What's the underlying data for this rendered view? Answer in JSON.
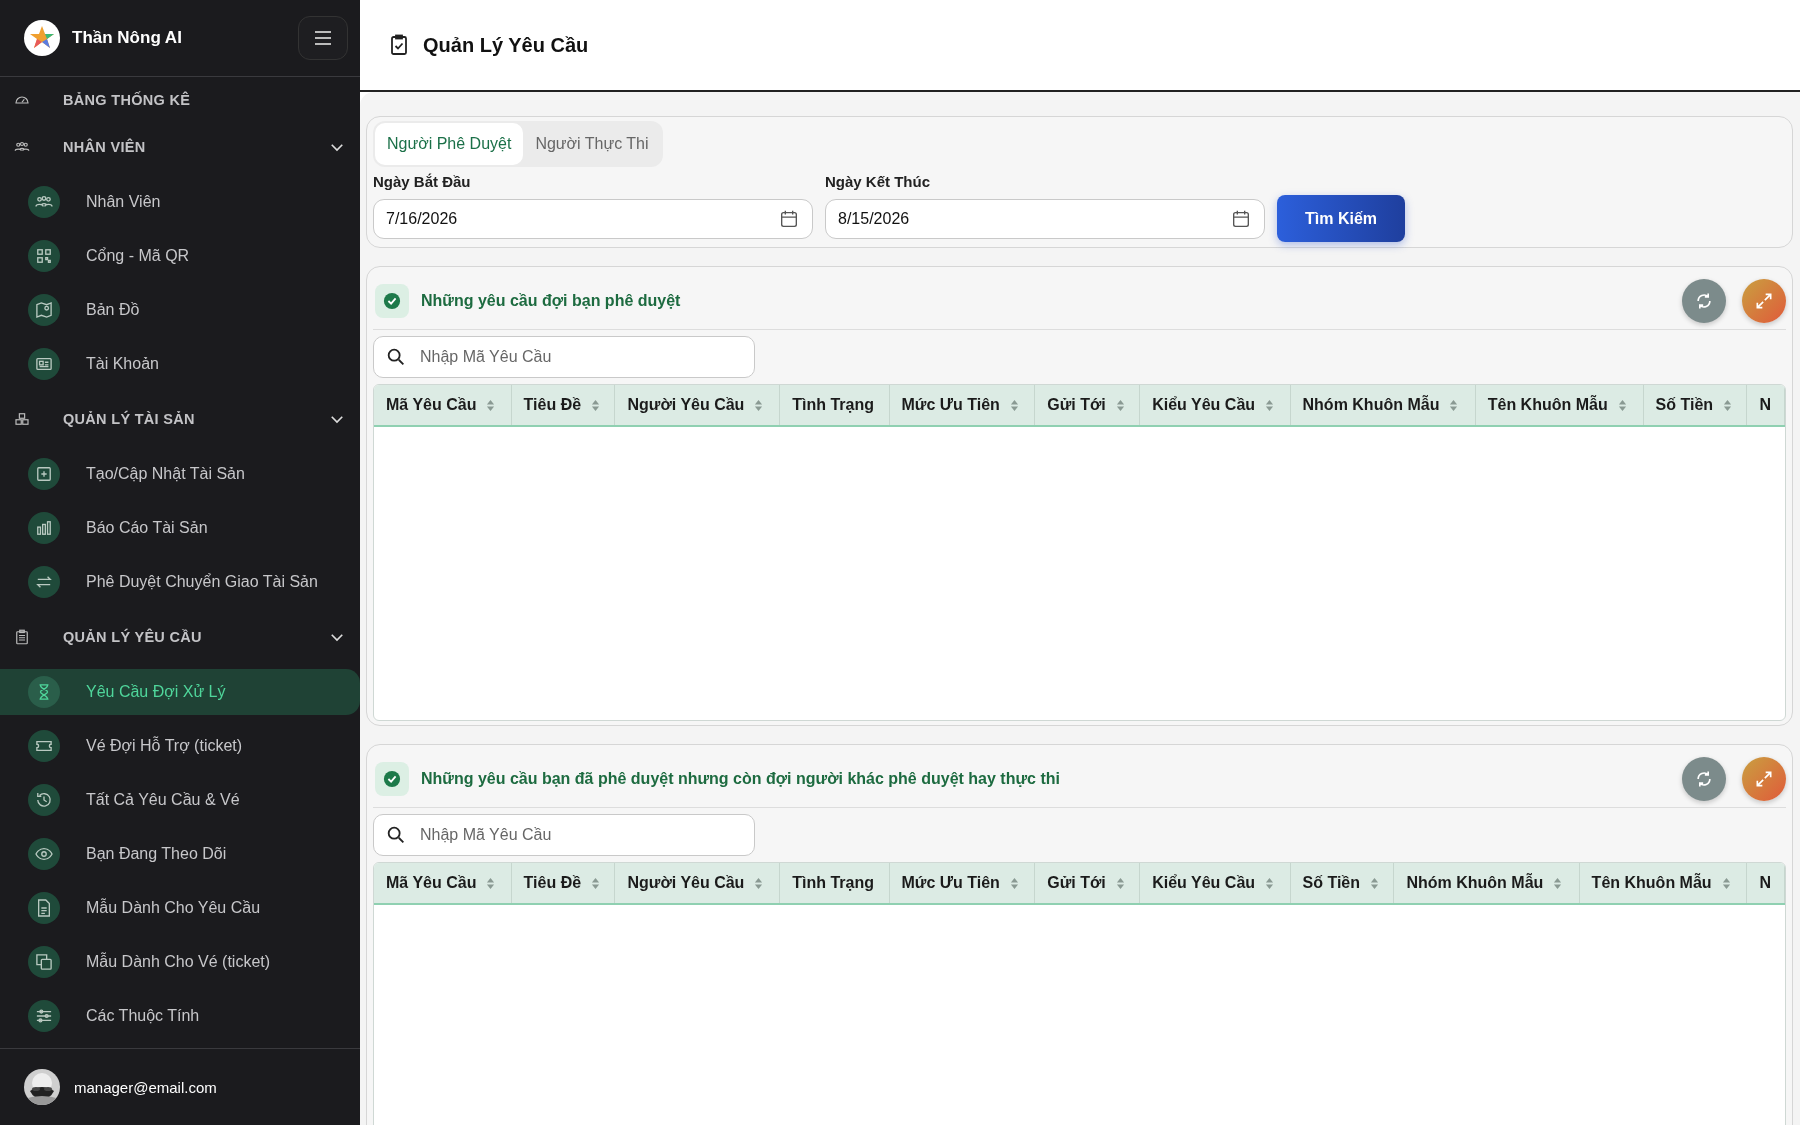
{
  "sidebar": {
    "brand": "Thần Nông AI",
    "sections": [
      {
        "kind": "link",
        "label": "BẢNG THỐNG KÊ"
      },
      {
        "kind": "group",
        "label": "NHÂN VIÊN",
        "expanded": true,
        "children": [
          {
            "label": "Nhân Viên",
            "selected": false
          },
          {
            "label": "Cổng - Mã QR",
            "selected": false
          },
          {
            "label": "Bản Đồ",
            "selected": false
          },
          {
            "label": "Tài Khoản",
            "selected": false
          }
        ]
      },
      {
        "kind": "group",
        "label": "QUẢN LÝ TÀI SẢN",
        "expanded": true,
        "children": [
          {
            "label": "Tạo/Cập Nhật Tài Sản",
            "selected": false
          },
          {
            "label": "Báo Cáo Tài Sản",
            "selected": false
          },
          {
            "label": "Phê Duyệt Chuyển Giao Tài Sản",
            "selected": false
          }
        ]
      },
      {
        "kind": "group",
        "label": "QUẢN LÝ YÊU CẦU",
        "expanded": true,
        "children": [
          {
            "label": "Yêu Cầu Đợi Xử Lý",
            "selected": true
          },
          {
            "label": "Vé Đợi Hỗ Trợ (ticket)",
            "selected": false
          },
          {
            "label": "Tất Cả Yêu Cầu & Vé",
            "selected": false
          },
          {
            "label": "Bạn Đang Theo Dõi",
            "selected": false
          },
          {
            "label": "Mẫu Dành Cho Yêu Cầu",
            "selected": false
          },
          {
            "label": "Mẫu Dành Cho Vé (ticket)",
            "selected": false
          },
          {
            "label": "Các Thuộc Tính",
            "selected": false
          }
        ]
      }
    ],
    "user": {
      "email": "manager@email.com"
    }
  },
  "header": {
    "title": "Quản Lý Yêu Cầu"
  },
  "filters": {
    "tabs": [
      {
        "label": "Người Phê Duyệt",
        "selected": true
      },
      {
        "label": "Người Thực Thi",
        "selected": false
      }
    ],
    "start": {
      "label": "Ngày Bắt Đầu",
      "value": "7/16/2026"
    },
    "end": {
      "label": "Ngày Kết Thúc",
      "value": "8/15/2026"
    },
    "button": "Tìm Kiếm"
  },
  "tables": [
    {
      "title": "Những yêu cầu đợi bạn phê duyệt",
      "search": {
        "placeholder": "Nhập Mã Yêu Cầu"
      },
      "columns": [
        {
          "label": "Mã Yêu Cầu",
          "sortable": true
        },
        {
          "label": "Tiêu Đề",
          "sortable": true
        },
        {
          "label": "Người Yêu Cầu",
          "sortable": true
        },
        {
          "label": "Tình Trạng",
          "sortable": false
        },
        {
          "label": "Mức Ưu Tiên",
          "sortable": true
        },
        {
          "label": "Gửi Tới",
          "sortable": true
        },
        {
          "label": "Kiểu Yêu Cầu",
          "sortable": true
        },
        {
          "label": "Nhóm Khuôn Mẫu",
          "sortable": true
        },
        {
          "label": "Tên Khuôn Mẫu",
          "sortable": true
        },
        {
          "label": "Số Tiền",
          "sortable": true
        },
        {
          "label": "N",
          "sortable": false
        }
      ]
    },
    {
      "title": "Những yêu cầu bạn đã phê duyệt nhưng còn đợi người khác phê duyệt hay thực thi",
      "search": {
        "placeholder": "Nhập Mã Yêu Cầu"
      },
      "columns": [
        {
          "label": "Mã Yêu Cầu",
          "sortable": true
        },
        {
          "label": "Tiêu Đề",
          "sortable": true
        },
        {
          "label": "Người Yêu Cầu",
          "sortable": true
        },
        {
          "label": "Tình Trạng",
          "sortable": false
        },
        {
          "label": "Mức Ưu Tiên",
          "sortable": true
        },
        {
          "label": "Gửi Tới",
          "sortable": true
        },
        {
          "label": "Kiểu Yêu Cầu",
          "sortable": true
        },
        {
          "label": "Số Tiền",
          "sortable": true
        },
        {
          "label": "Nhóm Khuôn Mẫu",
          "sortable": true
        },
        {
          "label": "Tên Khuôn Mẫu",
          "sortable": true
        },
        {
          "label": "N",
          "sortable": false
        }
      ]
    }
  ]
}
